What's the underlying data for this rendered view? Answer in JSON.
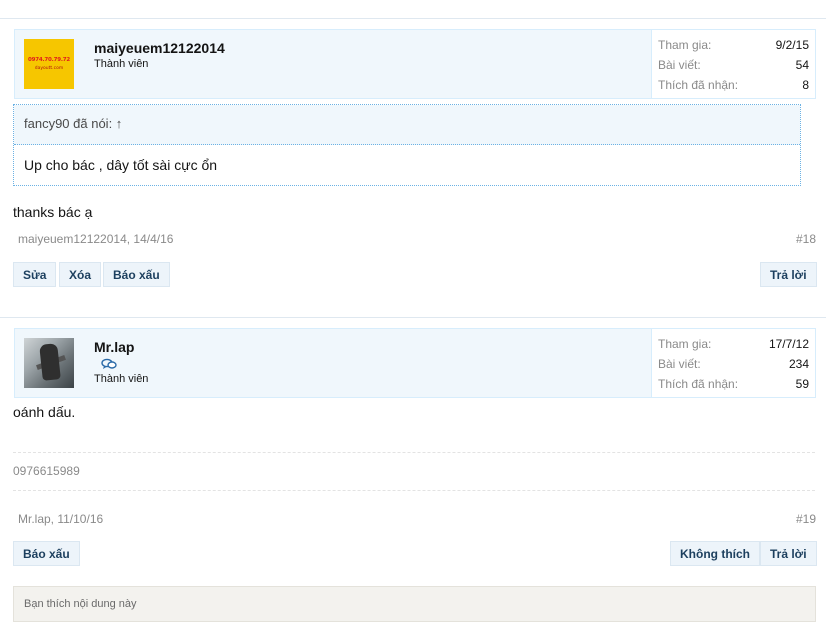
{
  "post18": {
    "user": {
      "name": "maiyeuem12122014",
      "title": "Thành viên",
      "avatar_text": {
        "phone": "0974.70.79.72",
        "domain": "dayoutt.com"
      }
    },
    "stats": [
      {
        "label": "Tham gia:",
        "value": "9/2/15"
      },
      {
        "label": "Bài viết:",
        "value": "54"
      },
      {
        "label": "Thích đã nhận:",
        "value": "8"
      }
    ],
    "quote": {
      "author": "fancy90 đã nói: ↑",
      "text": "Up cho bác , dây tốt sài cực ổn"
    },
    "message": "thanks bác ạ",
    "meta": "maiyeuem12122014, 14/4/16",
    "number": "#18",
    "buttons": {
      "edit": "Sửa",
      "delete": "Xóa",
      "report": "Báo xấu",
      "reply": "Trả lời"
    }
  },
  "post19": {
    "user": {
      "name": "Mr.lap",
      "title": "Thành viên",
      "icon": "chat-bubbles-icon"
    },
    "stats": [
      {
        "label": "Tham gia:",
        "value": "17/7/12"
      },
      {
        "label": "Bài viết:",
        "value": "234"
      },
      {
        "label": "Thích đã nhận:",
        "value": "59"
      }
    ],
    "message": "oánh dấu.",
    "signature": "0976615989",
    "meta": "Mr.lap, 11/10/16",
    "number": "#19",
    "buttons": {
      "report": "Báo xấu",
      "dislike": "Không thích",
      "reply": "Trả lời"
    },
    "likes_text": "Bạn thích nội dung này"
  },
  "colors": {
    "userbar_bg": "#f0f7fc",
    "button_text": "#1c3f5e",
    "quote_border": "#6cb2e4"
  }
}
